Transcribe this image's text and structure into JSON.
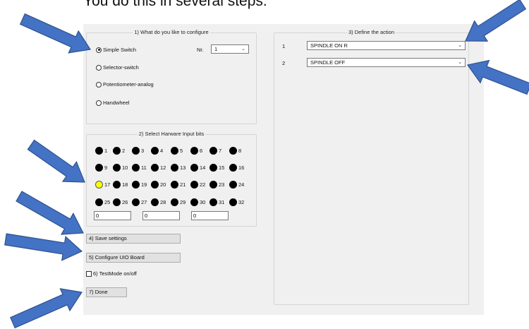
{
  "caption": "You do this in several steps.",
  "configure": {
    "title": "1) What do you like to configure",
    "options": [
      {
        "label": "Simple Switch",
        "checked": true
      },
      {
        "label": "Selector-switch",
        "checked": false
      },
      {
        "label": "Potentiometer-analog",
        "checked": false
      },
      {
        "label": "Handwheel",
        "checked": false
      }
    ],
    "nr_label": "Nr.",
    "nr_value": "1"
  },
  "action": {
    "title": "3) Define the action",
    "rows": [
      {
        "index": "1",
        "value": "SPINDLE ON R"
      },
      {
        "index": "2",
        "value": "SPINDLE OFF"
      }
    ]
  },
  "inputs": {
    "title": "2) Select Harware Input bits",
    "bits": [
      [
        "1",
        "2",
        "3",
        "4",
        "5",
        "6",
        "7",
        "8"
      ],
      [
        "9",
        "10",
        "11",
        "12",
        "13",
        "14",
        "15",
        "16"
      ],
      [
        "17",
        "18",
        "19",
        "20",
        "21",
        "22",
        "23",
        "24"
      ],
      [
        "25",
        "26",
        "27",
        "28",
        "29",
        "30",
        "31",
        "32"
      ]
    ],
    "active_bit": "17",
    "fields": [
      "0",
      "0",
      "0"
    ]
  },
  "buttons": {
    "save": "4) Save settings",
    "configure_board": "5) Configure UIO Board",
    "test_mode": "6) TestMode on/off",
    "done": "7) Done"
  },
  "colors": {
    "arrow": "#4472c4",
    "arrow_border": "#2f528f",
    "active_bit": "#ffff00",
    "panel": "#f0f0f0"
  }
}
